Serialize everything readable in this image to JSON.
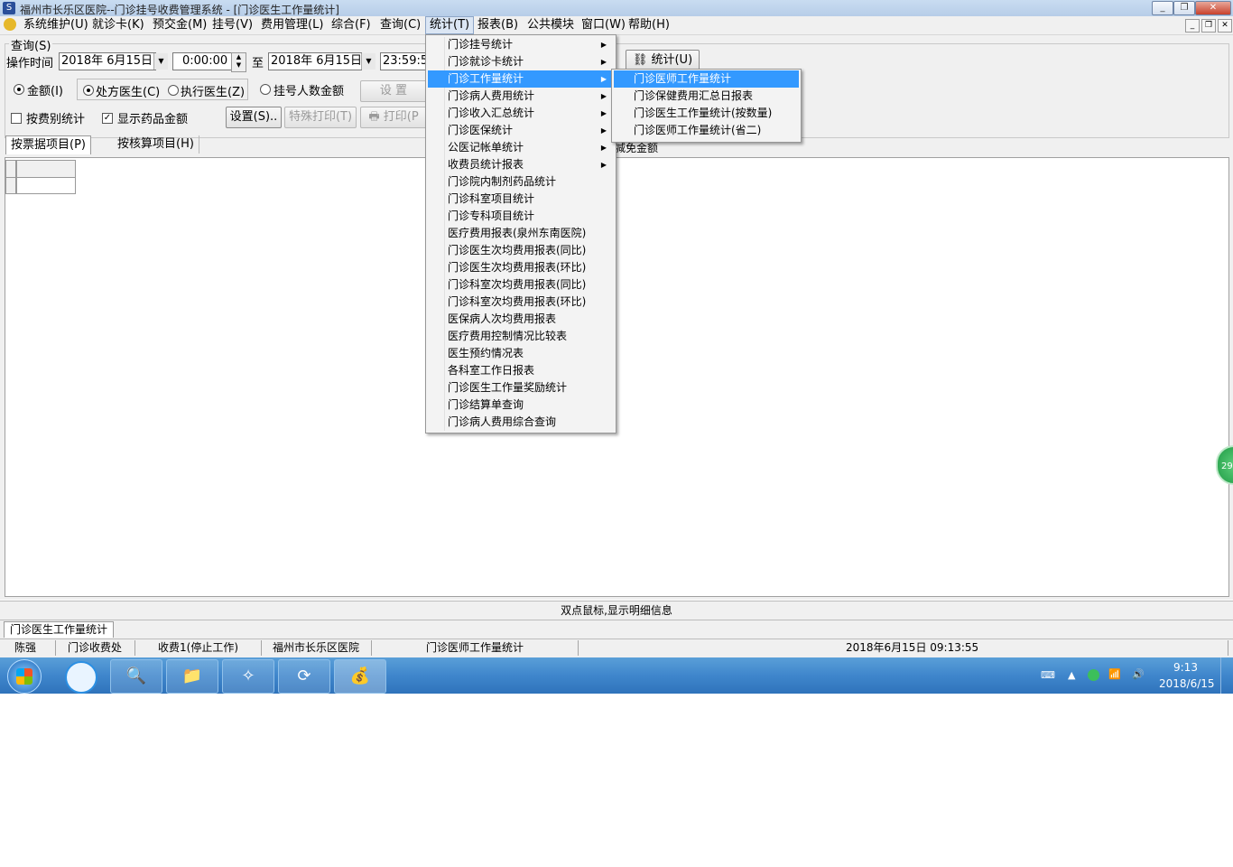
{
  "window": {
    "title": "福州市长乐区医院--门诊挂号收费管理系统 - [门诊医生工作量统计]"
  },
  "menubar": {
    "items": [
      "系统维护(U)",
      "就诊卡(K)",
      "预交金(M)",
      "挂号(V)",
      "费用管理(L)",
      "综合(F)",
      "查询(C)",
      "统计(T)",
      "报表(B)",
      "公共模块",
      "窗口(W)",
      "帮助(H)"
    ]
  },
  "query": {
    "group_label": "查询(S)",
    "time_label": "操作时间",
    "start_date": "2018年 6月15日",
    "start_time": "0:00:00",
    "to_label": "至",
    "end_date": "2018年 6月15日",
    "end_time": "23:59:5",
    "stat_button": "统计(U)",
    "radio_amount": "金额(I)",
    "radio_prescriber": "处方医生(C)",
    "radio_executor": "执行医生(Z)",
    "radio_reg_count": "挂号人数金额",
    "setup_button_disabled": "设 置",
    "check_by_fee": "按费别统计",
    "check_drug_amount": "显示药品金额",
    "settings_button": "设置(S)..",
    "special_print_button": "特殊打印(T)",
    "print_button": "打印(P"
  },
  "tabs": {
    "tab1": "按票据项目(P)",
    "tab2": "按核算项目(H)",
    "partial_header": "减免金额"
  },
  "stats_menu": {
    "items": [
      {
        "label": "门诊挂号统计",
        "sub": true
      },
      {
        "label": "门诊就诊卡统计",
        "sub": true
      },
      {
        "label": "门诊工作量统计",
        "sub": true,
        "highlight": true
      },
      {
        "label": "门诊病人费用统计",
        "sub": true
      },
      {
        "label": "门诊收入汇总统计",
        "sub": true
      },
      {
        "label": "门诊医保统计",
        "sub": true
      },
      {
        "label": "公医记帐单统计",
        "sub": true
      },
      {
        "label": "收费员统计报表",
        "sub": true
      },
      {
        "label": "门诊院内制剂药品统计",
        "sub": false
      },
      {
        "label": "门诊科室项目统计",
        "sub": false
      },
      {
        "label": "门诊专科项目统计",
        "sub": false
      },
      {
        "label": "医疗费用报表(泉州东南医院)",
        "sub": false
      },
      {
        "label": "门诊医生次均费用报表(同比)",
        "sub": false
      },
      {
        "label": "门诊医生次均费用报表(环比)",
        "sub": false
      },
      {
        "label": "门诊科室次均费用报表(同比)",
        "sub": false
      },
      {
        "label": "门诊科室次均费用报表(环比)",
        "sub": false
      },
      {
        "label": "医保病人次均费用报表",
        "sub": false
      },
      {
        "label": "医疗费用控制情况比较表",
        "sub": false
      },
      {
        "label": "医生预约情况表",
        "sub": false
      },
      {
        "label": "各科室工作日报表",
        "sub": false
      },
      {
        "label": "门诊医生工作量奖励统计",
        "sub": false
      },
      {
        "label": "门诊结算单查询",
        "sub": false
      },
      {
        "label": "门诊病人费用综合查询",
        "sub": false
      }
    ]
  },
  "workload_submenu": {
    "items": [
      {
        "label": "门诊医师工作量统计",
        "highlight": true
      },
      {
        "label": "门诊保健费用汇总日报表",
        "highlight": false
      },
      {
        "label": "门诊医生工作量统计(按数量)",
        "highlight": false
      },
      {
        "label": "门诊医师工作量统计(省二)",
        "highlight": false
      }
    ]
  },
  "hint_bar": "双点鼠标,显示明细信息",
  "doc_tab": "门诊医生工作量统计",
  "statusbar": {
    "user": "陈强",
    "dept": "门诊收费处",
    "station": "收费1(停止工作)",
    "hospital": "福州市长乐区医院",
    "module": "门诊医师工作量统计",
    "datetime": "2018年6月15日  09:13:55"
  },
  "float_badge": "29",
  "taskbar": {
    "clock_time": "9:13",
    "clock_date": "2018/6/15"
  }
}
